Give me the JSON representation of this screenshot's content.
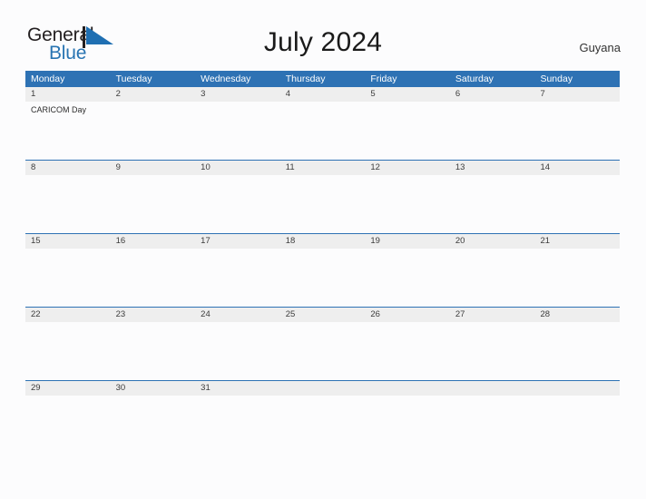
{
  "brand": {
    "name_part1": "General",
    "name_part2": "Blue",
    "mark": "triangle-flag-icon",
    "primary_color": "#2874b2"
  },
  "header": {
    "title": "July 2024",
    "region": "Guyana"
  },
  "calendar": {
    "header_color": "#2e72b4",
    "date_band_color": "#eeeeee",
    "weekdays": [
      {
        "label": "Monday"
      },
      {
        "label": "Tuesday"
      },
      {
        "label": "Wednesday"
      },
      {
        "label": "Thursday"
      },
      {
        "label": "Friday"
      },
      {
        "label": "Saturday"
      },
      {
        "label": "Sunday"
      }
    ],
    "weeks": [
      {
        "days": [
          {
            "date": "1",
            "events": [
              "CARICOM Day"
            ]
          },
          {
            "date": "2",
            "events": []
          },
          {
            "date": "3",
            "events": []
          },
          {
            "date": "4",
            "events": []
          },
          {
            "date": "5",
            "events": []
          },
          {
            "date": "6",
            "events": []
          },
          {
            "date": "7",
            "events": []
          }
        ]
      },
      {
        "days": [
          {
            "date": "8",
            "events": []
          },
          {
            "date": "9",
            "events": []
          },
          {
            "date": "10",
            "events": []
          },
          {
            "date": "11",
            "events": []
          },
          {
            "date": "12",
            "events": []
          },
          {
            "date": "13",
            "events": []
          },
          {
            "date": "14",
            "events": []
          }
        ]
      },
      {
        "days": [
          {
            "date": "15",
            "events": []
          },
          {
            "date": "16",
            "events": []
          },
          {
            "date": "17",
            "events": []
          },
          {
            "date": "18",
            "events": []
          },
          {
            "date": "19",
            "events": []
          },
          {
            "date": "20",
            "events": []
          },
          {
            "date": "21",
            "events": []
          }
        ]
      },
      {
        "days": [
          {
            "date": "22",
            "events": []
          },
          {
            "date": "23",
            "events": []
          },
          {
            "date": "24",
            "events": []
          },
          {
            "date": "25",
            "events": []
          },
          {
            "date": "26",
            "events": []
          },
          {
            "date": "27",
            "events": []
          },
          {
            "date": "28",
            "events": []
          }
        ]
      },
      {
        "days": [
          {
            "date": "29",
            "events": []
          },
          {
            "date": "30",
            "events": []
          },
          {
            "date": "31",
            "events": []
          },
          {
            "date": "",
            "events": []
          },
          {
            "date": "",
            "events": []
          },
          {
            "date": "",
            "events": []
          },
          {
            "date": "",
            "events": []
          }
        ]
      }
    ]
  }
}
